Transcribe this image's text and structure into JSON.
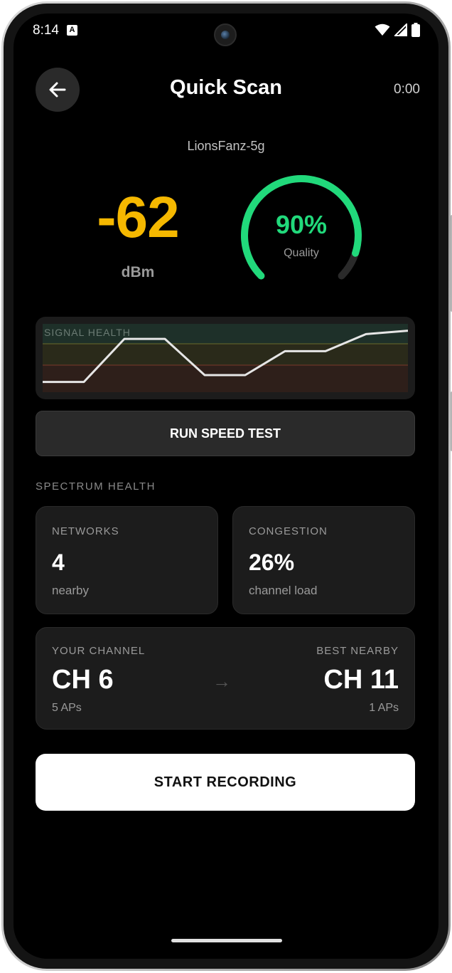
{
  "status_bar": {
    "time": "8:14",
    "notification_icon": "A",
    "icons": [
      "wifi-icon",
      "cell-signal-icon",
      "battery-icon"
    ]
  },
  "header": {
    "title": "Quick Scan",
    "timer": "0:00",
    "back_icon": "arrow-left-icon"
  },
  "network": {
    "ssid": "LionsFanz-5g",
    "signal_value": "-62",
    "signal_unit": "dBm",
    "quality_value": "90%",
    "quality_fraction": 0.9,
    "quality_label": "Quality"
  },
  "signal_health": {
    "label": "SIGNAL HEALTH",
    "series": [
      0.15,
      0.15,
      0.78,
      0.78,
      0.25,
      0.25,
      0.6,
      0.6,
      0.85,
      0.9
    ]
  },
  "speed_test": {
    "label": "RUN SPEED TEST"
  },
  "spectrum": {
    "title": "SPECTRUM HEALTH",
    "networks": {
      "label": "NETWORKS",
      "value": "4",
      "sub": "nearby"
    },
    "congestion": {
      "label": "CONGESTION",
      "value": "26%",
      "sub": "channel load"
    },
    "channel": {
      "your_label": "YOUR CHANNEL",
      "your_value": "CH 6",
      "your_sub": "5 APs",
      "arrow": "→",
      "best_label": "BEST NEARBY",
      "best_value": "CH 11",
      "best_sub": "1 APs"
    }
  },
  "record": {
    "label": "START RECORDING"
  },
  "colors": {
    "signal": "#f5b800",
    "quality": "#21d97b",
    "background": "#000000",
    "card": "#1c1c1c"
  }
}
